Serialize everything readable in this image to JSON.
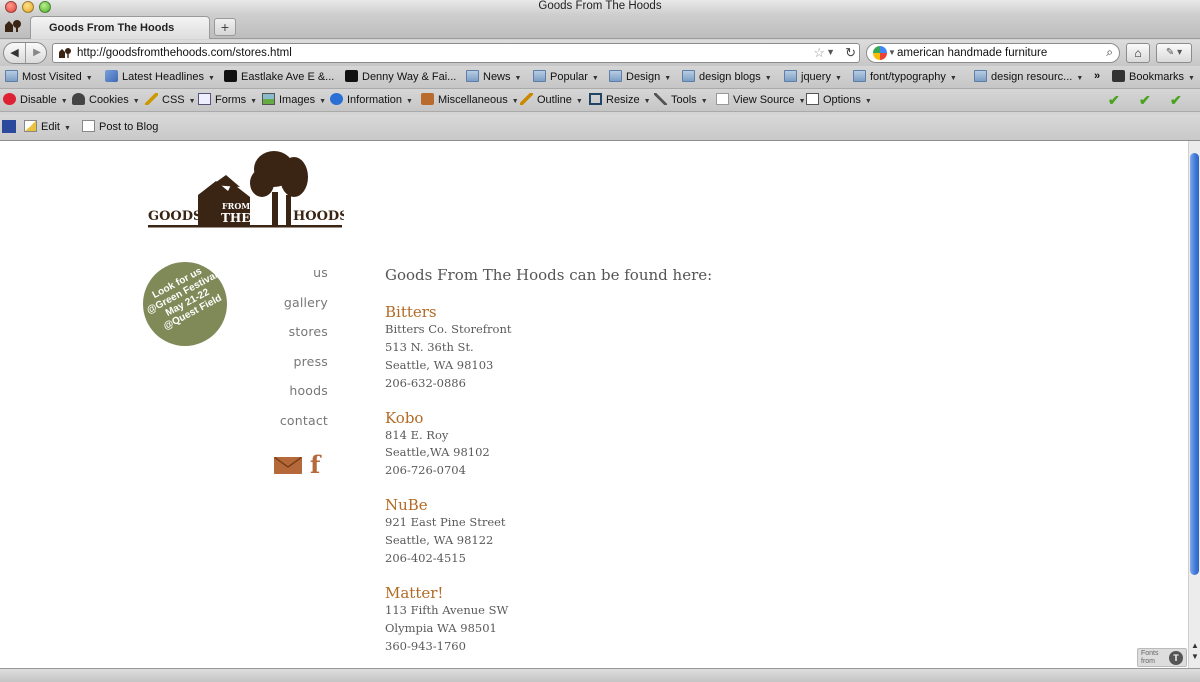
{
  "window": {
    "title": "Goods From The Hoods"
  },
  "tabs": [
    {
      "label": "Goods From The Hoods"
    }
  ],
  "navbar": {
    "url": "http://goodsfromthehoods.com/stores.html",
    "search_value": "american handmade furniture"
  },
  "bookmarks": [
    {
      "label": "Most Visited",
      "icon": "folder-icon"
    },
    {
      "label": "Latest Headlines",
      "icon": "rss-icon"
    },
    {
      "label": "Eastlake Ave E &...",
      "icon": "bus-icon"
    },
    {
      "label": "Denny Way & Fai...",
      "icon": "bus-icon"
    },
    {
      "label": "News",
      "icon": "folder-icon"
    },
    {
      "label": "Popular",
      "icon": "folder-icon"
    },
    {
      "label": "Design",
      "icon": "folder-icon"
    },
    {
      "label": "design blogs",
      "icon": "folder-icon"
    },
    {
      "label": "jquery",
      "icon": "folder-icon"
    },
    {
      "label": "font/typography",
      "icon": "folder-icon"
    },
    {
      "label": "design resourc...",
      "icon": "folder-icon"
    }
  ],
  "bookmarks_overflow": "»",
  "bookmarks_menu": "Bookmarks",
  "webdev": [
    {
      "label": "Disable"
    },
    {
      "label": "Cookies"
    },
    {
      "label": "CSS"
    },
    {
      "label": "Forms"
    },
    {
      "label": "Images"
    },
    {
      "label": "Information"
    },
    {
      "label": "Miscellaneous"
    },
    {
      "label": "Outline"
    },
    {
      "label": "Resize"
    },
    {
      "label": "Tools"
    },
    {
      "label": "View Source"
    },
    {
      "label": "Options"
    }
  ],
  "blogbar": {
    "edit": "Edit",
    "post": "Post to Blog"
  },
  "site": {
    "logo": {
      "word1": "GOODS",
      "word2": "FROM",
      "word3": "THE",
      "word4": "HOODS"
    },
    "badge": [
      "Look for us",
      "@Green Festival",
      "May 21-22",
      "@Quest Field"
    ],
    "nav": [
      "us",
      "gallery",
      "stores",
      "press",
      "hoods",
      "contact"
    ],
    "intro": "Goods From The Hoods can be found here:",
    "stores": [
      {
        "name": "Bitters",
        "lines": [
          "Bitters Co. Storefront",
          "513 N. 36th St.",
          "Seattle, WA 98103",
          "206-632-0886"
        ]
      },
      {
        "name": "Kobo",
        "lines": [
          "814 E. Roy",
          "Seattle,WA 98102",
          "206-726-0704"
        ]
      },
      {
        "name": "NuBe",
        "lines": [
          "921 East Pine Street",
          "Seattle, WA 98122",
          "206-402-4515"
        ]
      },
      {
        "name": "Matter!",
        "lines": [
          "113 Fifth Avenue SW",
          "Olympia WA 98501",
          "360-943-1760"
        ]
      }
    ]
  },
  "fonts_badge": {
    "line1": "Fonts",
    "line2": "from"
  },
  "colors": {
    "accent": "#b36a25",
    "badge": "#7f8a58",
    "logo": "#3a2414"
  }
}
